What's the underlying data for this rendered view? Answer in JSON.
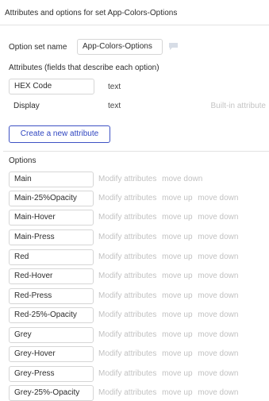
{
  "header": {
    "title": "Attributes and options for set App-Colors-Options"
  },
  "option_set": {
    "label": "Option set name",
    "value": "App-Colors-Options"
  },
  "attributes": {
    "heading": "Attributes (fields that describe each option)",
    "items": [
      {
        "name": "HEX Code",
        "type": "text"
      },
      {
        "name": "Display",
        "type": "text",
        "note": "Built-in attribute"
      }
    ],
    "create_label": "Create a new attribute"
  },
  "options": {
    "heading": "Options",
    "actions": {
      "modify": "Modify attributes",
      "up": "move up",
      "down": "move down"
    },
    "items": [
      {
        "name": "Main"
      },
      {
        "name": "Main-25%Opacity"
      },
      {
        "name": "Main-Hover"
      },
      {
        "name": "Main-Press"
      },
      {
        "name": "Red"
      },
      {
        "name": "Red-Hover"
      },
      {
        "name": "Red-Press"
      },
      {
        "name": "Red-25%-Opacity"
      },
      {
        "name": "Grey"
      },
      {
        "name": "Grey-Hover"
      },
      {
        "name": "Grey-Press"
      },
      {
        "name": "Grey-25%-Opacity"
      }
    ]
  },
  "colors": {
    "accent": "#3e52c4",
    "muted": "#c2c2c2",
    "border": "#d6d6d6"
  }
}
